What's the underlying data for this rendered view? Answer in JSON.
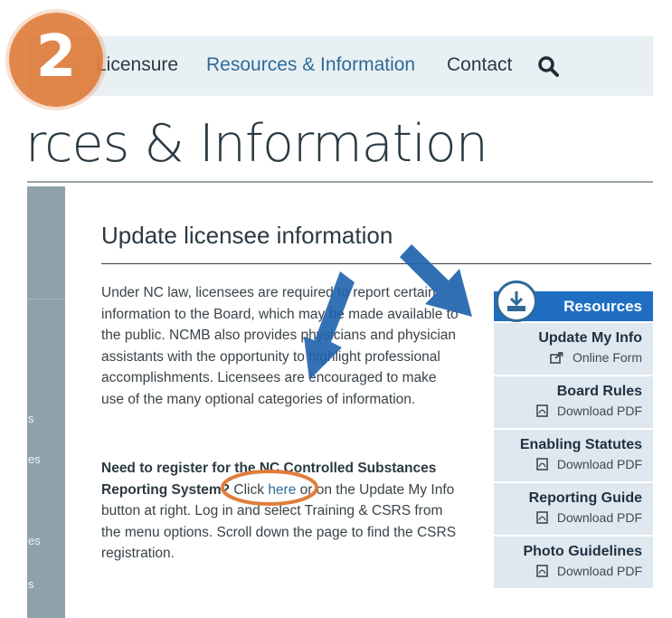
{
  "badge": {
    "number": "2"
  },
  "nav": {
    "items": [
      "Licensure",
      "Resources & Information",
      "Contact"
    ],
    "active_index": 1,
    "search_icon": "search-icon"
  },
  "page": {
    "title": "rces & Information"
  },
  "sidebar": {
    "fragments": [
      "s",
      "es",
      "es",
      "s"
    ]
  },
  "section": {
    "title": "Update licensee information",
    "para1": "Under NC law, licensees are required to report certain information to the Board, which may be made available to the public. NCMB also provides physicians and physician assistants with the opportunity to highlight professional accomplishments. Licensees are encouraged to make use of the many optional categories of information.",
    "para2_bold": "Need to register for the NC Controlled Substances Reporting System?",
    "para2_a": " Click ",
    "para2_link": "here",
    "para2_b": " or on the Update My Info button at right. Log in and select Training & CSRS from the menu options. Scroll down the page to find the CSRS registration."
  },
  "resources": {
    "header": "Resources",
    "icon": "download-icon",
    "items": [
      {
        "title": "Update My Info",
        "sub": "Online Form",
        "icon": "external-link-icon"
      },
      {
        "title": "Board Rules",
        "sub": "Download PDF",
        "icon": "pdf-icon"
      },
      {
        "title": "Enabling Statutes",
        "sub": "Download PDF",
        "icon": "pdf-icon"
      },
      {
        "title": "Reporting Guide",
        "sub": "Download PDF",
        "icon": "pdf-icon"
      },
      {
        "title": "Photo Guidelines",
        "sub": "Download PDF",
        "icon": "pdf-icon"
      }
    ]
  },
  "colors": {
    "accent": "#e07d3c",
    "link": "#2f6b97",
    "resources_header": "#1f6ec3",
    "arrow": "#1f63ad"
  }
}
